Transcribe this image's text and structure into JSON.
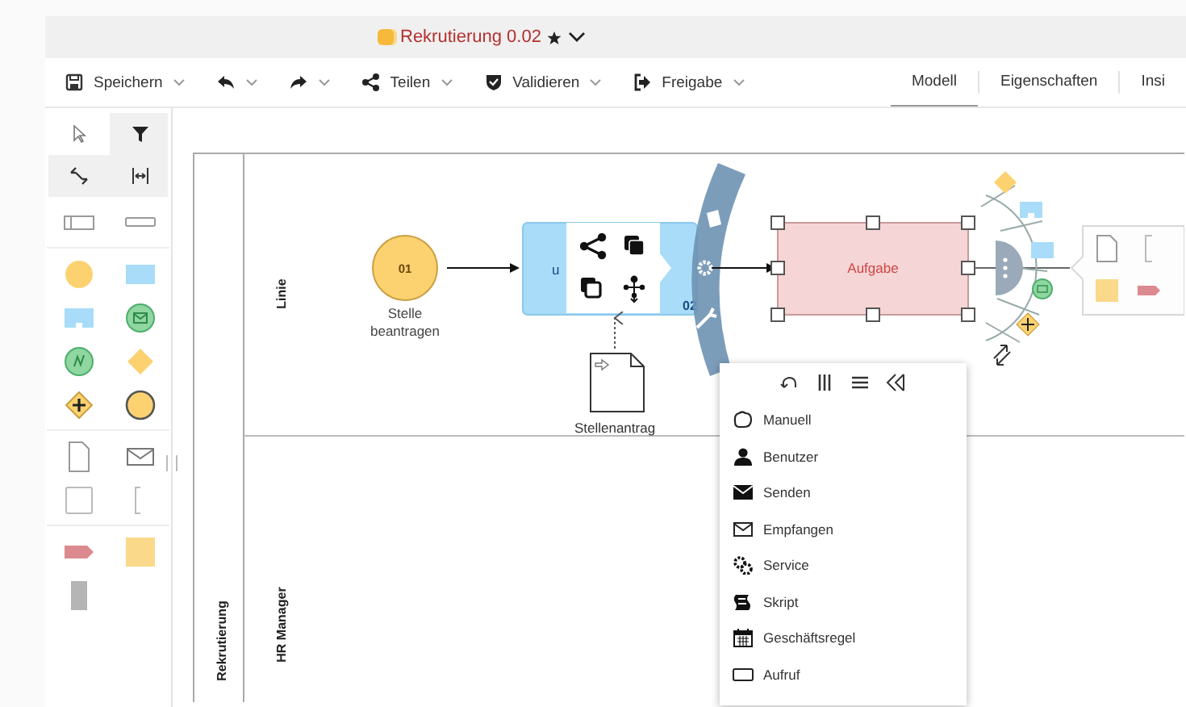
{
  "title": {
    "text": "Rekrutierung 0.02",
    "starred": true
  },
  "toolbar": [
    {
      "kind": "save",
      "label": "Speichern"
    },
    {
      "kind": "undo"
    },
    {
      "kind": "redo"
    },
    {
      "kind": "share",
      "label": "Teilen"
    },
    {
      "kind": "validate",
      "label": "Validieren"
    },
    {
      "kind": "release",
      "label": "Freigabe"
    }
  ],
  "view_tabs": [
    {
      "label": "Modell",
      "selected": true
    },
    {
      "label": "Eigenschaften",
      "selected": false
    },
    {
      "label": "Insi",
      "selected": false
    }
  ],
  "palette_tools": [
    {
      "kind": "pointer",
      "selected": true
    },
    {
      "kind": "filter",
      "selected": false
    },
    {
      "kind": "connect",
      "selected": false
    },
    {
      "kind": "space",
      "selected": false
    }
  ],
  "pool": {
    "label": "Rekrutierung",
    "lanes": [
      {
        "label": "Linie"
      },
      {
        "label": "HR Manager"
      }
    ]
  },
  "start_event": {
    "number": "01",
    "label": "Stelle beantragen"
  },
  "task": {
    "label": "u",
    "number": "02"
  },
  "data_object": {
    "label": "Stellenantrag"
  },
  "selected_task": {
    "label": "Aufgabe"
  },
  "task_type_menu": [
    {
      "kind": "manual",
      "label": "Manuell"
    },
    {
      "kind": "user",
      "label": "Benutzer"
    },
    {
      "kind": "send",
      "label": "Senden"
    },
    {
      "kind": "receive",
      "label": "Empfangen"
    },
    {
      "kind": "service",
      "label": "Service"
    },
    {
      "kind": "script",
      "label": "Skript"
    },
    {
      "kind": "rule",
      "label": "Geschäftsregel"
    },
    {
      "kind": "call",
      "label": "Aufruf"
    }
  ]
}
